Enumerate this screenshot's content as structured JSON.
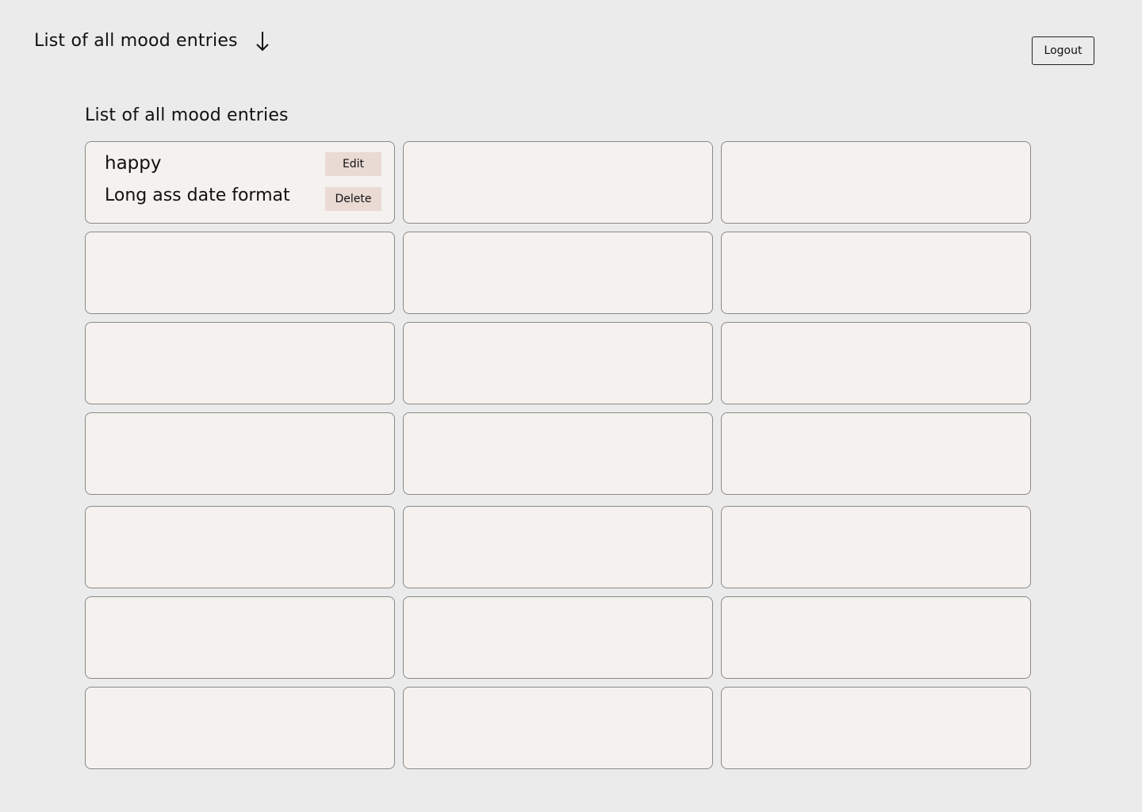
{
  "header": {
    "title": "List of all mood entries",
    "arrow_icon": "arrow-down-icon",
    "logout_label": "Logout"
  },
  "section": {
    "title": "List of all mood entries"
  },
  "entries": [
    {
      "mood": "happy",
      "date": "Long ass date format",
      "edit_label": "Edit",
      "delete_label": "Delete"
    }
  ],
  "colors": {
    "background": "#EBEBEB",
    "card_background": "#F4F1EE",
    "card_border": "#8A8A8A",
    "button_background": "#EADAD4"
  }
}
